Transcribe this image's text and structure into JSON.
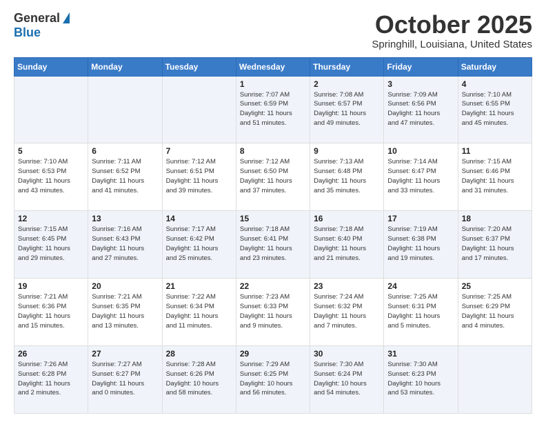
{
  "logo": {
    "general": "General",
    "blue": "Blue"
  },
  "header": {
    "month": "October 2025",
    "location": "Springhill, Louisiana, United States"
  },
  "weekdays": [
    "Sunday",
    "Monday",
    "Tuesday",
    "Wednesday",
    "Thursday",
    "Friday",
    "Saturday"
  ],
  "weeks": [
    [
      {
        "day": "",
        "info": ""
      },
      {
        "day": "",
        "info": ""
      },
      {
        "day": "",
        "info": ""
      },
      {
        "day": "1",
        "info": "Sunrise: 7:07 AM\nSunset: 6:59 PM\nDaylight: 11 hours\nand 51 minutes."
      },
      {
        "day": "2",
        "info": "Sunrise: 7:08 AM\nSunset: 6:57 PM\nDaylight: 11 hours\nand 49 minutes."
      },
      {
        "day": "3",
        "info": "Sunrise: 7:09 AM\nSunset: 6:56 PM\nDaylight: 11 hours\nand 47 minutes."
      },
      {
        "day": "4",
        "info": "Sunrise: 7:10 AM\nSunset: 6:55 PM\nDaylight: 11 hours\nand 45 minutes."
      }
    ],
    [
      {
        "day": "5",
        "info": "Sunrise: 7:10 AM\nSunset: 6:53 PM\nDaylight: 11 hours\nand 43 minutes."
      },
      {
        "day": "6",
        "info": "Sunrise: 7:11 AM\nSunset: 6:52 PM\nDaylight: 11 hours\nand 41 minutes."
      },
      {
        "day": "7",
        "info": "Sunrise: 7:12 AM\nSunset: 6:51 PM\nDaylight: 11 hours\nand 39 minutes."
      },
      {
        "day": "8",
        "info": "Sunrise: 7:12 AM\nSunset: 6:50 PM\nDaylight: 11 hours\nand 37 minutes."
      },
      {
        "day": "9",
        "info": "Sunrise: 7:13 AM\nSunset: 6:48 PM\nDaylight: 11 hours\nand 35 minutes."
      },
      {
        "day": "10",
        "info": "Sunrise: 7:14 AM\nSunset: 6:47 PM\nDaylight: 11 hours\nand 33 minutes."
      },
      {
        "day": "11",
        "info": "Sunrise: 7:15 AM\nSunset: 6:46 PM\nDaylight: 11 hours\nand 31 minutes."
      }
    ],
    [
      {
        "day": "12",
        "info": "Sunrise: 7:15 AM\nSunset: 6:45 PM\nDaylight: 11 hours\nand 29 minutes."
      },
      {
        "day": "13",
        "info": "Sunrise: 7:16 AM\nSunset: 6:43 PM\nDaylight: 11 hours\nand 27 minutes."
      },
      {
        "day": "14",
        "info": "Sunrise: 7:17 AM\nSunset: 6:42 PM\nDaylight: 11 hours\nand 25 minutes."
      },
      {
        "day": "15",
        "info": "Sunrise: 7:18 AM\nSunset: 6:41 PM\nDaylight: 11 hours\nand 23 minutes."
      },
      {
        "day": "16",
        "info": "Sunrise: 7:18 AM\nSunset: 6:40 PM\nDaylight: 11 hours\nand 21 minutes."
      },
      {
        "day": "17",
        "info": "Sunrise: 7:19 AM\nSunset: 6:38 PM\nDaylight: 11 hours\nand 19 minutes."
      },
      {
        "day": "18",
        "info": "Sunrise: 7:20 AM\nSunset: 6:37 PM\nDaylight: 11 hours\nand 17 minutes."
      }
    ],
    [
      {
        "day": "19",
        "info": "Sunrise: 7:21 AM\nSunset: 6:36 PM\nDaylight: 11 hours\nand 15 minutes."
      },
      {
        "day": "20",
        "info": "Sunrise: 7:21 AM\nSunset: 6:35 PM\nDaylight: 11 hours\nand 13 minutes."
      },
      {
        "day": "21",
        "info": "Sunrise: 7:22 AM\nSunset: 6:34 PM\nDaylight: 11 hours\nand 11 minutes."
      },
      {
        "day": "22",
        "info": "Sunrise: 7:23 AM\nSunset: 6:33 PM\nDaylight: 11 hours\nand 9 minutes."
      },
      {
        "day": "23",
        "info": "Sunrise: 7:24 AM\nSunset: 6:32 PM\nDaylight: 11 hours\nand 7 minutes."
      },
      {
        "day": "24",
        "info": "Sunrise: 7:25 AM\nSunset: 6:31 PM\nDaylight: 11 hours\nand 5 minutes."
      },
      {
        "day": "25",
        "info": "Sunrise: 7:25 AM\nSunset: 6:29 PM\nDaylight: 11 hours\nand 4 minutes."
      }
    ],
    [
      {
        "day": "26",
        "info": "Sunrise: 7:26 AM\nSunset: 6:28 PM\nDaylight: 11 hours\nand 2 minutes."
      },
      {
        "day": "27",
        "info": "Sunrise: 7:27 AM\nSunset: 6:27 PM\nDaylight: 11 hours\nand 0 minutes."
      },
      {
        "day": "28",
        "info": "Sunrise: 7:28 AM\nSunset: 6:26 PM\nDaylight: 10 hours\nand 58 minutes."
      },
      {
        "day": "29",
        "info": "Sunrise: 7:29 AM\nSunset: 6:25 PM\nDaylight: 10 hours\nand 56 minutes."
      },
      {
        "day": "30",
        "info": "Sunrise: 7:30 AM\nSunset: 6:24 PM\nDaylight: 10 hours\nand 54 minutes."
      },
      {
        "day": "31",
        "info": "Sunrise: 7:30 AM\nSunset: 6:23 PM\nDaylight: 10 hours\nand 53 minutes."
      },
      {
        "day": "",
        "info": ""
      }
    ]
  ]
}
